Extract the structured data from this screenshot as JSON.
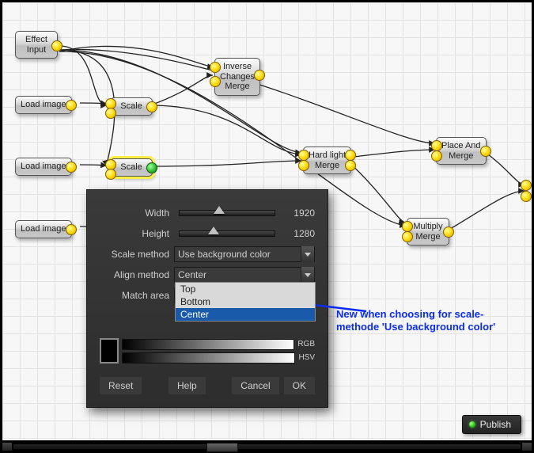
{
  "nodes": {
    "effect_input": "Effect\nInput",
    "load_image": "Load image",
    "scale": "Scale",
    "inverse_merge": "Inverse\nChanges\nMerge",
    "hard_light_merge": "Hard light\nMerge",
    "place_and_merge": "Place And\nMerge",
    "multiply_merge": "Multiply\nMerge"
  },
  "dialog": {
    "width_label": "Width",
    "width_value": "1920",
    "height_label": "Height",
    "height_value": "1280",
    "scale_method_label": "Scale method",
    "scale_method_value": "Use background color",
    "align_method_label": "Align method",
    "align_method_value": "Center",
    "align_options": {
      "top": "Top",
      "bottom": "Bottom",
      "center": "Center"
    },
    "match_area_label": "Match area",
    "rgb": "RGB",
    "hsv": "HSV",
    "reset": "Reset",
    "help": "Help",
    "cancel": "Cancel",
    "ok": "OK"
  },
  "annotation": {
    "line1": "New when choosing for scale-",
    "line2": "methode 'Use background color'"
  },
  "publish_label": "Publish"
}
